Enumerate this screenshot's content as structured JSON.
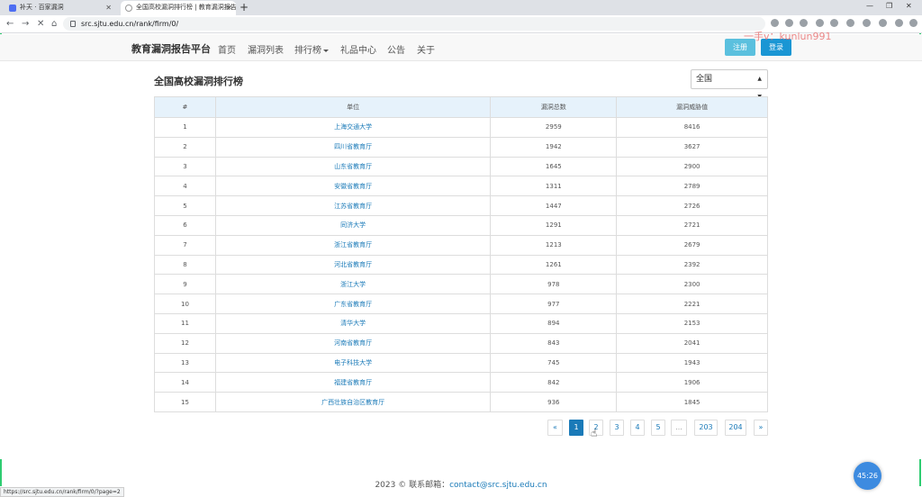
{
  "browser": {
    "tabs": [
      {
        "title": "补天 · 百家漏洞"
      },
      {
        "title": "全国高校漏洞排行榜 | 教育漏洞报告"
      }
    ],
    "new_tab": "+",
    "url": "src.sjtu.edu.cn/rank/firm/0/",
    "status_url": "https://src.sjtu.edu.cn/rank/firm/0/?page=2"
  },
  "site": {
    "brand": "教育漏洞报告平台",
    "nav": [
      "首页",
      "漏洞列表",
      "排行榜",
      "礼品中心",
      "公告",
      "关于"
    ],
    "register_label": "注册",
    "login_label": "登录",
    "watermark": "一手v：kunlun991"
  },
  "main": {
    "title": "全国高校漏洞排行榜",
    "region_select": "全国",
    "columns": [
      "#",
      "单位",
      "漏洞总数",
      "漏洞威胁值"
    ],
    "rows": [
      {
        "rank": "1",
        "unit": "上海交通大学",
        "total": "2959",
        "threat": "8416"
      },
      {
        "rank": "2",
        "unit": "四川省教育厅",
        "total": "1942",
        "threat": "3627"
      },
      {
        "rank": "3",
        "unit": "山东省教育厅",
        "total": "1645",
        "threat": "2900"
      },
      {
        "rank": "4",
        "unit": "安徽省教育厅",
        "total": "1311",
        "threat": "2789"
      },
      {
        "rank": "5",
        "unit": "江苏省教育厅",
        "total": "1447",
        "threat": "2726"
      },
      {
        "rank": "6",
        "unit": "同济大学",
        "total": "1291",
        "threat": "2721"
      },
      {
        "rank": "7",
        "unit": "浙江省教育厅",
        "total": "1213",
        "threat": "2679"
      },
      {
        "rank": "8",
        "unit": "河北省教育厅",
        "total": "1261",
        "threat": "2392"
      },
      {
        "rank": "9",
        "unit": "浙江大学",
        "total": "978",
        "threat": "2300"
      },
      {
        "rank": "10",
        "unit": "广东省教育厅",
        "total": "977",
        "threat": "2221"
      },
      {
        "rank": "11",
        "unit": "清华大学",
        "total": "894",
        "threat": "2153"
      },
      {
        "rank": "12",
        "unit": "河南省教育厅",
        "total": "843",
        "threat": "2041"
      },
      {
        "rank": "13",
        "unit": "电子科技大学",
        "total": "745",
        "threat": "1943"
      },
      {
        "rank": "14",
        "unit": "福建省教育厅",
        "total": "842",
        "threat": "1906"
      },
      {
        "rank": "15",
        "unit": "广西壮族自治区教育厅",
        "total": "936",
        "threat": "1845"
      }
    ],
    "pagination": [
      "«",
      "1",
      "2",
      "3",
      "4",
      "5",
      "...",
      "203",
      "204",
      "»"
    ]
  },
  "footer": {
    "text": "2023 © 联系邮箱：",
    "email": "contact@src.sjtu.edu.cn"
  },
  "overlay": {
    "timer": "45:26"
  }
}
